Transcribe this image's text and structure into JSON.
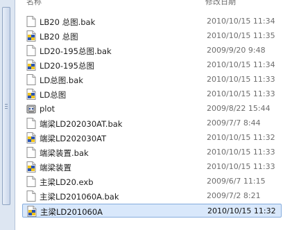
{
  "header": {
    "name_label": "名称",
    "date_label": "修改日期"
  },
  "files": [
    {
      "name": "LB20 总图.bak",
      "date": "2010/10/15 11:34",
      "icon": "document-icon"
    },
    {
      "name": "LB20 总图",
      "date": "2010/10/15 11:35",
      "icon": "cad-drawing-icon"
    },
    {
      "name": "LD20-195总图.bak",
      "date": "2009/9/20 9:48",
      "icon": "document-icon"
    },
    {
      "name": "LD20-195总图",
      "date": "2010/10/15 11:34",
      "icon": "cad-drawing-icon"
    },
    {
      "name": "LD总图.bak",
      "date": "2010/10/15 11:33",
      "icon": "document-icon"
    },
    {
      "name": "LD总图",
      "date": "2010/10/15 11:33",
      "icon": "cad-drawing-icon"
    },
    {
      "name": "plot",
      "date": "2009/8/22 15:44",
      "icon": "plot-settings-icon"
    },
    {
      "name": "端梁LD202030AT.bak",
      "date": "2009/7/7 8:44",
      "icon": "document-icon"
    },
    {
      "name": "端梁LD202030AT",
      "date": "2010/10/15 11:32",
      "icon": "cad-drawing-icon"
    },
    {
      "name": "端梁装置.bak",
      "date": "2010/10/15 11:33",
      "icon": "document-icon"
    },
    {
      "name": "端梁装置",
      "date": "2010/10/15 11:33",
      "icon": "cad-drawing-icon"
    },
    {
      "name": "主梁LD20.exb",
      "date": "2009/6/7 11:15",
      "icon": "document-icon"
    },
    {
      "name": "主梁LD201060A.bak",
      "date": "2009/7/2 8:21",
      "icon": "document-icon"
    },
    {
      "name": "主梁LD201060A",
      "date": "2010/10/15 11:32",
      "icon": "cad-drawing-icon",
      "selected": true
    }
  ]
}
